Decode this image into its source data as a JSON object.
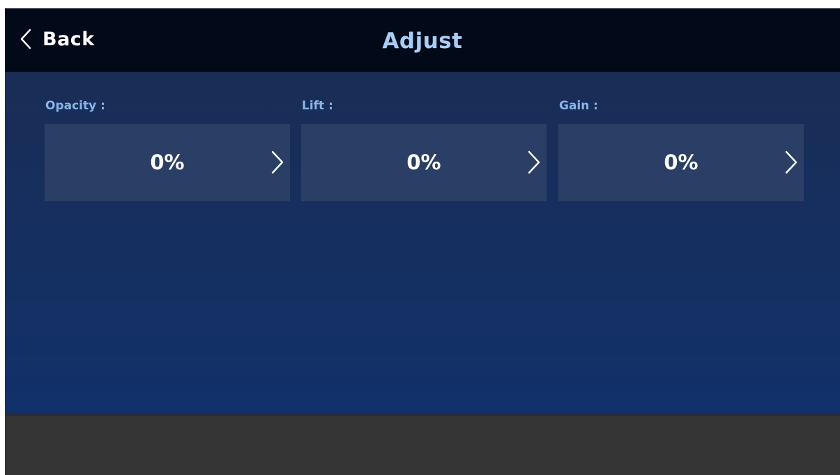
{
  "header": {
    "back_label": "Back",
    "title": "Adjust"
  },
  "params": [
    {
      "label": "Opacity :",
      "value": "0%"
    },
    {
      "label": "Lift :",
      "value": "0%"
    },
    {
      "label": "Gain :",
      "value": "0%"
    }
  ],
  "icons": {
    "back": "chevron-left-icon",
    "next": "chevron-right-icon"
  },
  "colors": {
    "topbar": "#020a1a",
    "panel": "#0f2a62",
    "title": "#a9cdf5",
    "label": "#8ab4ea",
    "box": "#2b3f66",
    "footer": "#353535"
  }
}
